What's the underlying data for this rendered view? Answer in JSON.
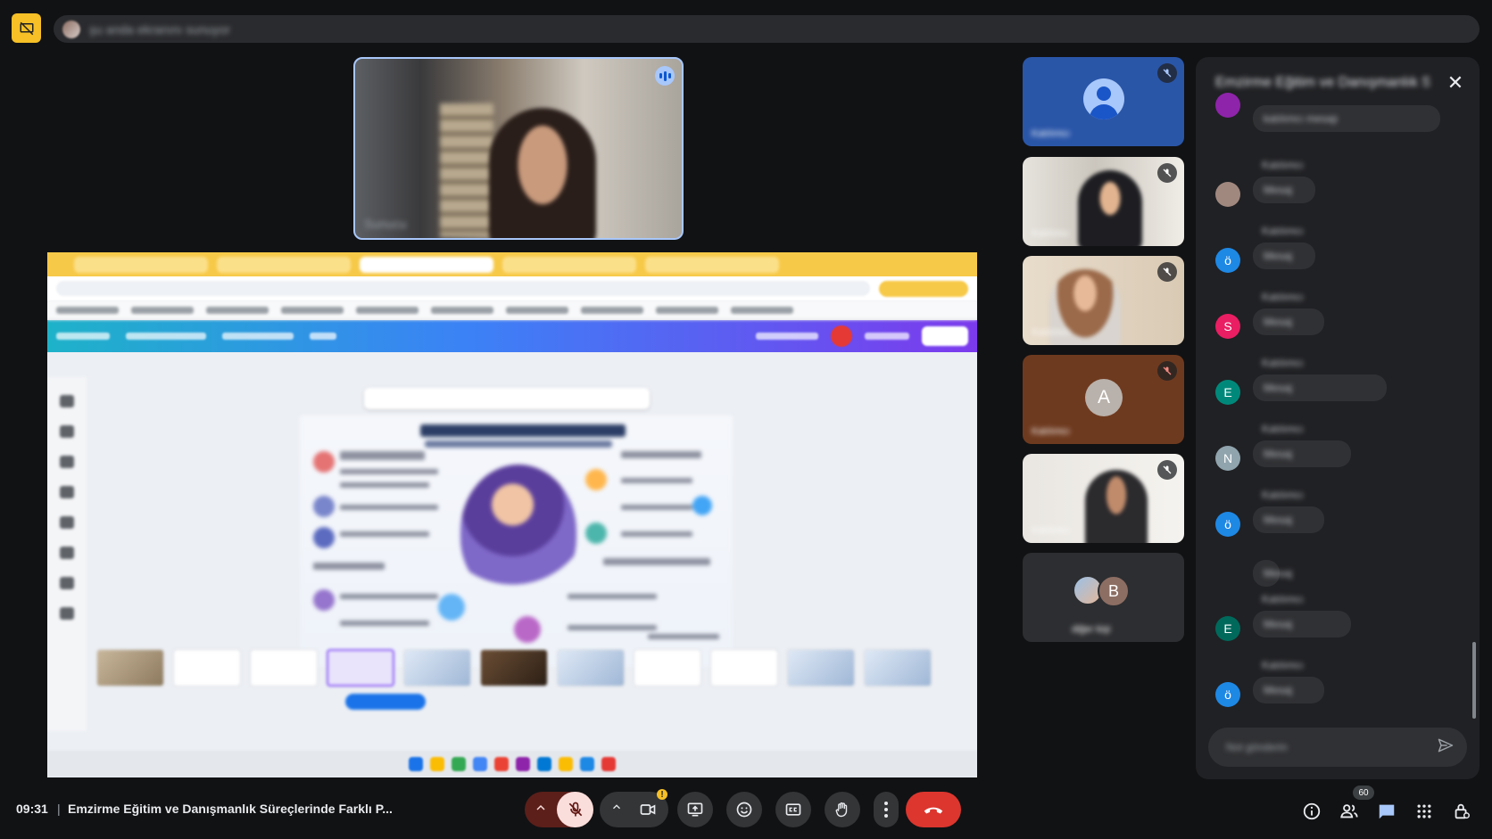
{
  "meeting": {
    "time": "09:31",
    "separator": "|",
    "title": "Emzirme Eğitim ve Danışmanlık Süreçlerinde Farklı P..."
  },
  "notice": {
    "text": "şu anda ekranını sunuyor"
  },
  "presenter": {
    "name": "Sunucu"
  },
  "screen_share": {
    "app": "Canva",
    "avatar_initials": "GG",
    "poster_title": "Emzirmenin Görünmeyen Gücü:",
    "poster_subtitle": "Anne ve Bebek İçin Psikososyal Bir Rehber"
  },
  "participants": [
    {
      "name": "Katılımcı",
      "type": "avatar-icon",
      "muted": true
    },
    {
      "name": "Katılımcı",
      "type": "video",
      "muted": true
    },
    {
      "name": "Katılımcı",
      "type": "video",
      "muted": false
    },
    {
      "name": "Katılımcı",
      "initial": "A",
      "type": "initial",
      "muted": true
    },
    {
      "name": "Katılımcı",
      "type": "video",
      "muted": true
    },
    {
      "name": "diğer kişi",
      "initial": "B",
      "type": "group",
      "muted": false
    }
  ],
  "chat": {
    "title": "Emzirme Eğitim ve Danışmanlık S...",
    "input_placeholder": "Not gönderin",
    "messages": [
      {
        "initial": "",
        "color": "#8e24aa",
        "sender": "",
        "text": "katılımcı mesajı"
      },
      {
        "initial": "",
        "color": "#a1887f",
        "sender": "Katılımcı",
        "text": "Mesaj"
      },
      {
        "initial": "ö",
        "color": "#1e88e5",
        "sender": "Katılımcı",
        "text": "Mesaj"
      },
      {
        "initial": "S",
        "color": "#e91e63",
        "sender": "Katılımcı",
        "text": "Mesaj"
      },
      {
        "initial": "E",
        "color": "#00897b",
        "sender": "Katılımcı",
        "text": "Mesaj"
      },
      {
        "initial": "N",
        "color": "#90a4ae",
        "sender": "Katılımcı",
        "text": "Mesaj"
      },
      {
        "initial": "ö",
        "color": "#1e88e5",
        "sender": "Katılımcı",
        "text": "Mesaj"
      },
      {
        "initial": "",
        "color": "",
        "sender": "",
        "text": "Mesaj"
      },
      {
        "initial": "E",
        "color": "#00695c",
        "sender": "Katılımcı",
        "text": "Mesaj"
      },
      {
        "initial": "ö",
        "color": "#1e88e5",
        "sender": "Katılımcı",
        "text": "Mesaj"
      }
    ]
  },
  "people_count": "60",
  "colors": {
    "accent": "#a8c7fa",
    "hangup": "#dc362e",
    "mic_off_bg": "#f9dedc",
    "warning": "#f6c026"
  }
}
